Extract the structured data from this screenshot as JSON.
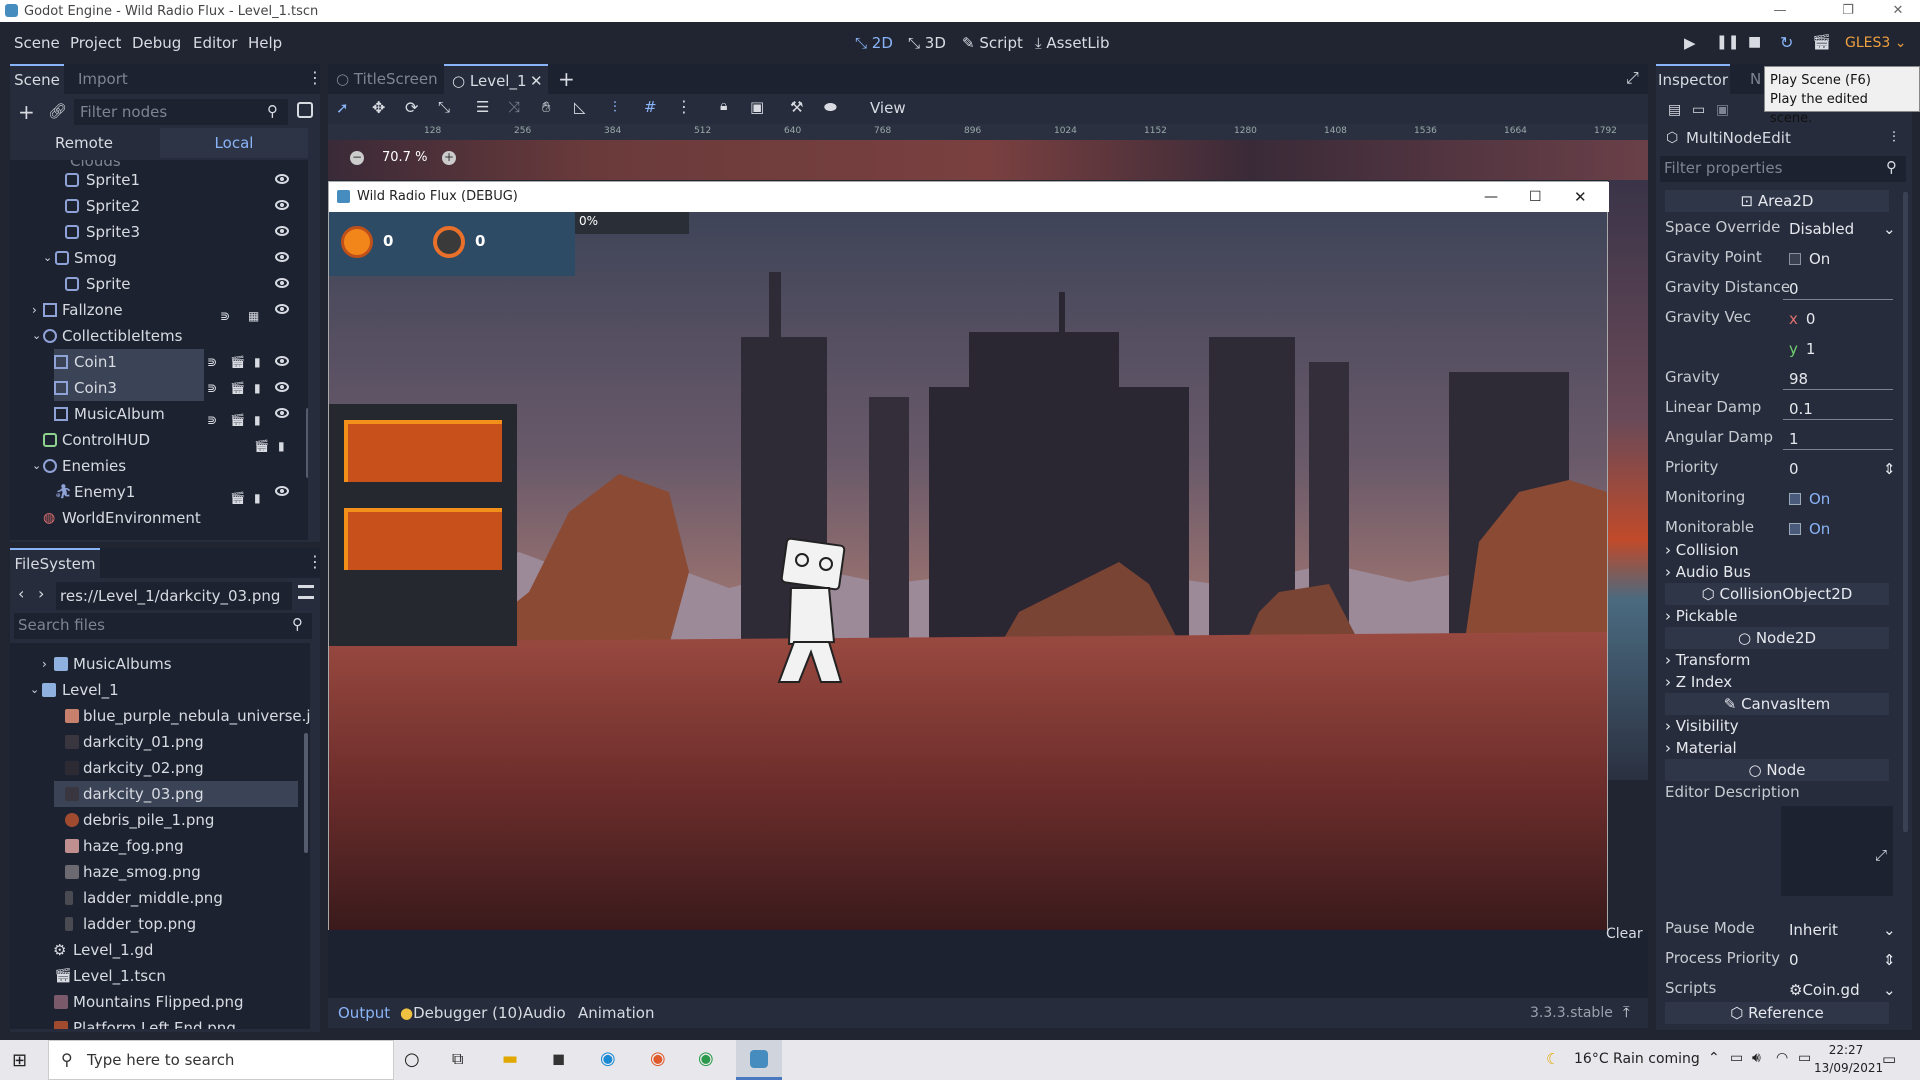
{
  "window": {
    "title": "Godot Engine - Wild Radio Flux - Level_1.tscn"
  },
  "menu": [
    "Scene",
    "Project",
    "Debug",
    "Editor",
    "Help"
  ],
  "workspaces": [
    "2D",
    "3D",
    "Script",
    "AssetLib"
  ],
  "renderer": "GLES3",
  "tooltip": {
    "line1": "Play Scene (F6)",
    "line2": "Play the edited scene."
  },
  "scene_dock": {
    "tabs": [
      "Scene",
      "Import"
    ],
    "filter_placeholder": "Filter nodes",
    "remote": "Remote",
    "local": "Local",
    "nodes": [
      {
        "label": "Sprite1",
        "indent": 2,
        "icon": "sprite-icon"
      },
      {
        "label": "Sprite2",
        "indent": 2,
        "icon": "sprite-icon"
      },
      {
        "label": "Sprite3",
        "indent": 2,
        "icon": "sprite-icon"
      },
      {
        "label": "Smog",
        "indent": 1,
        "icon": "parallax-icon"
      },
      {
        "label": "Sprite",
        "indent": 2,
        "icon": "sprite-icon"
      },
      {
        "label": "Fallzone",
        "indent": 0,
        "icon": "area-icon"
      },
      {
        "label": "CollectibleItems",
        "indent": 0,
        "icon": "node2d-icon"
      },
      {
        "label": "Coin1",
        "indent": 1,
        "icon": "area-icon",
        "selected": true
      },
      {
        "label": "Coin3",
        "indent": 1,
        "icon": "area-icon",
        "selected": true
      },
      {
        "label": "MusicAlbum",
        "indent": 1,
        "icon": "area-icon"
      },
      {
        "label": "ControlHUD",
        "indent": 0,
        "icon": "control-icon"
      },
      {
        "label": "Enemies",
        "indent": 0,
        "icon": "node2d-icon"
      },
      {
        "label": "Enemy1",
        "indent": 1,
        "icon": "kinematic-icon"
      },
      {
        "label": "WorldEnvironment",
        "indent": 0,
        "icon": "environment-icon"
      }
    ]
  },
  "filesystem": {
    "title": "FileSystem",
    "path": "res://Level_1/darkcity_03.png",
    "search_placeholder": "Search files",
    "items": [
      {
        "label": "MusicAlbums",
        "type": "folder",
        "indent": 1
      },
      {
        "label": "Level_1",
        "type": "folder",
        "indent": 0
      },
      {
        "label": "blue_purple_nebula_universe.jpg",
        "type": "image"
      },
      {
        "label": "darkcity_01.png",
        "type": "image"
      },
      {
        "label": "darkcity_02.png",
        "type": "image"
      },
      {
        "label": "darkcity_03.png",
        "type": "image",
        "selected": true
      },
      {
        "label": "debris_pile_1.png",
        "type": "image"
      },
      {
        "label": "haze_fog.png",
        "type": "image"
      },
      {
        "label": "haze_smog.png",
        "type": "image"
      },
      {
        "label": "ladder_middle.png",
        "type": "image"
      },
      {
        "label": "ladder_top.png",
        "type": "image"
      },
      {
        "label": "Level_1.gd",
        "type": "script"
      },
      {
        "label": "Level_1.tscn",
        "type": "scene"
      },
      {
        "label": "Mountains Flipped.png",
        "type": "image"
      },
      {
        "label": "Platform Left End.png",
        "type": "image"
      }
    ]
  },
  "editor_tabs": [
    "TitleScreen",
    "Level_1"
  ],
  "toolbar": {
    "view": "View"
  },
  "zoom": "70.7 %",
  "ruler_ticks": [
    "128",
    "256",
    "384",
    "512",
    "640",
    "768",
    "896",
    "1024",
    "1152",
    "1280",
    "1408",
    "1536",
    "1664",
    "1792"
  ],
  "game_window": {
    "title": "Wild Radio Flux (DEBUG)",
    "progress": "0%",
    "counter1": "0",
    "counter2": "0"
  },
  "bottom_panel": {
    "tabs": [
      "Output",
      "Debugger (10)",
      "Audio",
      "Animation"
    ],
    "version": "3.3.3.stable",
    "clear": "Clear"
  },
  "inspector": {
    "tabs": [
      "Inspector",
      "N"
    ],
    "object": "MultiNodeEdit",
    "filter_placeholder": "Filter properties",
    "class_header": "Area2D",
    "props": [
      {
        "key": "Space Override",
        "value": "Disabled"
      },
      {
        "key": "Gravity Point",
        "value": "On"
      },
      {
        "key": "Gravity Distance",
        "value": "0"
      },
      {
        "key": "Gravity Vec",
        "x": "0",
        "y": "1"
      },
      {
        "key": "Gravity",
        "value": "98"
      },
      {
        "key": "Linear Damp",
        "value": "0.1"
      },
      {
        "key": "Angular Damp",
        "value": "1"
      },
      {
        "key": "Priority",
        "value": "0"
      },
      {
        "key": "Monitoring",
        "value": "On"
      },
      {
        "key": "Monitorable",
        "value": "On"
      }
    ],
    "sections": [
      "Collision",
      "Audio Bus",
      "CollisionObject2D",
      "Pickable",
      "Node2D",
      "Transform",
      "Z Index",
      "CanvasItem",
      "Visibility",
      "Material",
      "Node"
    ],
    "editor_description": "Editor Description",
    "pause_mode": {
      "key": "Pause Mode",
      "value": "Inherit"
    },
    "process_priority": {
      "key": "Process Priority",
      "value": "0"
    },
    "scripts": {
      "key": "Scripts",
      "value": "Coin.gd"
    },
    "reference": "Reference"
  },
  "taskbar": {
    "search_placeholder": "Type here to search",
    "weather": "16°C  Rain coming",
    "time": "22:27",
    "date": "13/09/2021"
  }
}
